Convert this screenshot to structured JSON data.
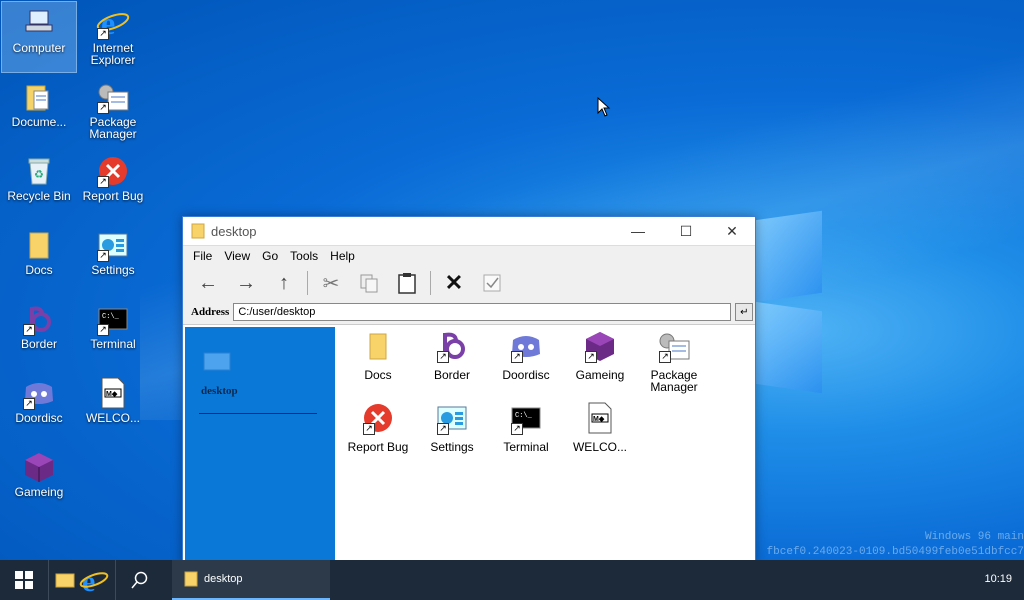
{
  "desktop_icons": {
    "computer": "Computer",
    "ie": "Internet Explorer",
    "documents": "Docume...",
    "package_manager": "Package Manager",
    "recycle": "Recycle Bin",
    "report_bug": "Report Bug",
    "docs": "Docs",
    "settings": "Settings",
    "border": "Border",
    "terminal": "Terminal",
    "doordisc": "Doordisc",
    "welcome": "WELCO...",
    "gameing": "Gameing"
  },
  "window": {
    "title": "desktop",
    "menu": [
      "File",
      "View",
      "Go",
      "Tools",
      "Help"
    ],
    "address_label": "Address",
    "address_value": "C:/user/desktop",
    "sidebar_title": "desktop",
    "files": {
      "docs": "Docs",
      "border": "Border",
      "doordisc": "Doordisc",
      "gameing": "Gameing",
      "package_manager": "Package Manager",
      "report_bug": "Report Bug",
      "settings": "Settings",
      "terminal": "Terminal",
      "welcome": "WELCO..."
    }
  },
  "taskbar": {
    "task_label": "desktop",
    "clock": "10:19"
  },
  "watermark": {
    "line1": "Windows 96 main",
    "line2": "fbcef0.240023-0109.bd50499feb0e51dbfcc7"
  },
  "colors": {
    "accent": "#0a78d7",
    "taskbar": "#1c2a3a"
  }
}
